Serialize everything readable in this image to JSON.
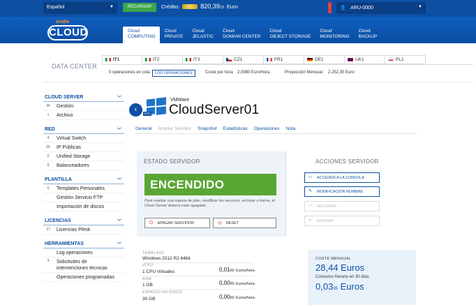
{
  "topbar": {
    "language": "Español",
    "recharge_label": "RECARGAR",
    "credit_label": "Crédito:",
    "credit_amount": "820,39",
    "credit_cents": "13",
    "credit_currency": "Euro",
    "notification": "!",
    "user": "ARU-0000"
  },
  "logo": {
    "brand_small": "aruba",
    "brand_big": "CLOUD"
  },
  "nav": [
    {
      "line1": "Cloud",
      "line2": "COMPUTING",
      "active": true
    },
    {
      "line1": "Cloud",
      "line2": "PRIVATE",
      "active": false
    },
    {
      "line1": "Cloud",
      "line2": "JELASTIC",
      "active": false
    },
    {
      "line1": "Cloud",
      "line2": "DOMAIN CENTER",
      "active": false
    },
    {
      "line1": "Cloud",
      "line2": "OBJECT STORAGE",
      "active": false
    },
    {
      "line1": "Cloud",
      "line2": "MONITORING",
      "active": false
    },
    {
      "line1": "Cloud",
      "line2": "BACKUP",
      "active": false
    }
  ],
  "datacenter": {
    "label": "DATA CENTER",
    "tabs": [
      "IT1",
      "IT2",
      "IT3",
      "CZ1",
      "FR1",
      "DE1",
      "UK1",
      "PL1"
    ],
    "queue": "0 operaciones en cola",
    "log_button": "LOG OPERACIONES",
    "hourly_cost_label": "Coste por hora",
    "hourly_cost_value": "2,0980",
    "hourly_cost_unit": "Euro/hora",
    "monthly_projection_label": "Proyección Mensual",
    "monthly_projection_value": "2.252,30",
    "monthly_projection_unit": "Euro"
  },
  "sidebar": {
    "sections": [
      {
        "title": "CLOUD SERVER",
        "items": [
          {
            "badge": "44",
            "label": "Gestión"
          },
          {
            "badge": "1",
            "label": "Archivo"
          }
        ]
      },
      {
        "title": "RED",
        "items": [
          {
            "badge": "4",
            "label": "Virtual Switch"
          },
          {
            "badge": "65",
            "label": "IP Públicas"
          },
          {
            "badge": "0",
            "label": "Unified Storage"
          },
          {
            "badge": "5",
            "label": "Balanceadores"
          }
        ]
      },
      {
        "title": "PLANTILLA",
        "items": [
          {
            "badge": "0",
            "label": "Templates Personales"
          },
          {
            "badge": "",
            "label": "Gestión Servicio FTP"
          },
          {
            "badge": "",
            "label": "Importación de discos"
          }
        ]
      },
      {
        "title": "LICENCIAS",
        "items": [
          {
            "badge": "17",
            "label": "Licencias Plesk"
          }
        ]
      },
      {
        "title": "HERRAMIENTAS",
        "items": [
          {
            "badge": "",
            "label": "Log operaciones"
          },
          {
            "badge": "4",
            "label": "Solicitudes de intervenciones técnicas"
          },
          {
            "badge": "",
            "label": "Operaciones programadas"
          }
        ]
      }
    ]
  },
  "server": {
    "hypervisor": "VMWare",
    "pro_badge": "PRO",
    "name": "CloudServer01",
    "tabs": [
      {
        "label": "General",
        "state": "active"
      },
      {
        "label": "Ampliar Servidor",
        "state": "disabled"
      },
      {
        "label": "Snapshot",
        "state": "normal"
      },
      {
        "label": "Estadísticas",
        "state": "normal"
      },
      {
        "label": "Operaciones",
        "state": "normal"
      },
      {
        "label": "Nota",
        "state": "normal"
      }
    ],
    "status_title": "ESTADO SERVIDOR",
    "status": "ENCENDIDO",
    "status_note": "Para realizar una mejora de plan, modificar los recursos, archivar o borrar, el Cloud Server deberá estar apagado.",
    "power_off_button": "APAGAR SERVIDOR",
    "reset_button": "RESET",
    "actions_title": "ACCIONES SERVIDOR",
    "actions": [
      {
        "label": "ACCEDER A LA CONSOLA",
        "enabled": true,
        "icon": "monitor-icon"
      },
      {
        "label": "MODIFICACIÓN NOMBRE",
        "enabled": true,
        "icon": "pencil-icon"
      },
      {
        "label": "ARCHIVAR",
        "enabled": false,
        "icon": "archive-icon"
      },
      {
        "label": "BORRAR",
        "enabled": false,
        "icon": "close-icon"
      }
    ]
  },
  "specs": {
    "template_label": "TEMPLATE",
    "template_value": "Windows 2012 R2 64bit",
    "vcpu_label": "vCPU",
    "vcpu_value": "1 CPU Virtuales",
    "vcpu_price_main": "0,01",
    "vcpu_price_small": "60",
    "vcpu_unit": "Euros/hora",
    "ram_label": "RAM",
    "ram_value": "1 GB",
    "ram_price_main": "0,00",
    "ram_price_small": "50",
    "ram_unit": "Euros/hora",
    "disk_label": "ESPACIO EN DISCO",
    "disk_value": "30 GB",
    "disk_price_main": "0,00",
    "disk_price_small": "60",
    "disk_unit": "Euros/hora"
  },
  "cost": {
    "monthly_label": "COSTE MENSUAL",
    "monthly_value": "28,44 Euros",
    "hourly_label": "Consumo Horario en 30 días",
    "hourly_main": "0,03",
    "hourly_small": "95",
    "hourly_unit": "Euros"
  },
  "colors": {
    "brand_blue": "#0d4fa3",
    "recharge_green": "#3aa64a",
    "status_green": "#5aa634",
    "alert_red": "#e23b3b"
  }
}
